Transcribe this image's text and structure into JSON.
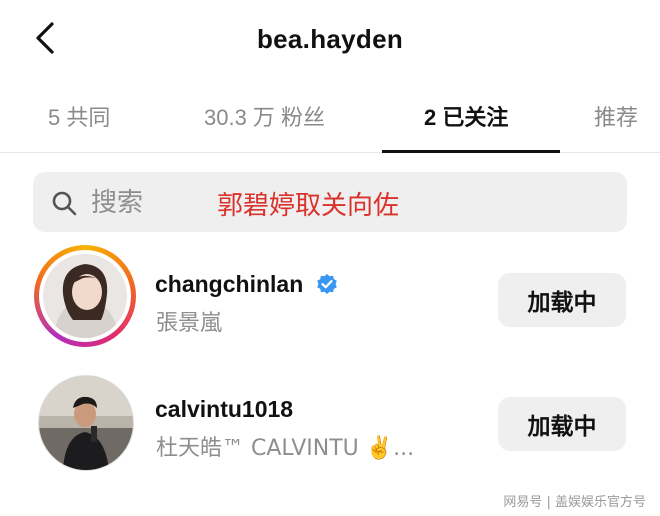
{
  "header": {
    "title": "bea.hayden"
  },
  "tabs": [
    {
      "label": "5 共同",
      "active": false
    },
    {
      "label": "30.3 万 粉丝",
      "active": false
    },
    {
      "label": "2 已关注",
      "active": true
    },
    {
      "label": "推荐",
      "active": false
    }
  ],
  "search": {
    "placeholder": "搜索"
  },
  "overlay_caption": "郭碧婷取关向佐",
  "following": [
    {
      "username": "changchinlan",
      "verified": true,
      "subtitle": "張景嵐",
      "button_label": "加载中",
      "has_story_ring": true
    },
    {
      "username": "calvintu1018",
      "verified": false,
      "subtitle": "杜天皓™ CALVINTU ✌️...",
      "button_label": "加载中",
      "has_story_ring": false
    }
  ],
  "watermark": "网易号 | 盖娱娱乐官方号",
  "colors": {
    "accent_text": "#d9322b",
    "muted_text": "#8e8e8e",
    "button_bg": "#efefef",
    "verified_badge": "#3897f0"
  }
}
